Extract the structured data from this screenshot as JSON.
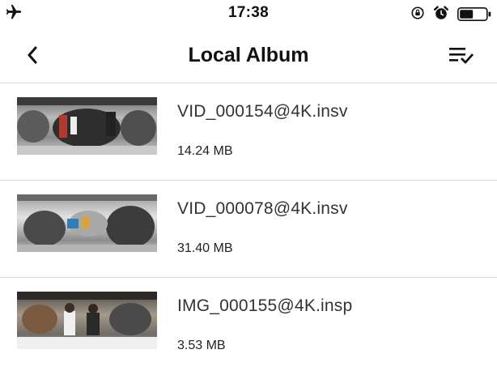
{
  "status_bar": {
    "time": "17:38",
    "icons": [
      "airplane-icon",
      "rotation-lock-icon",
      "alarm-icon",
      "battery-icon"
    ],
    "battery_level": 0.5
  },
  "nav": {
    "title": "Local Album",
    "back_icon": "chevron-left-icon",
    "select_icon": "multi-select-checklist-icon"
  },
  "files": [
    {
      "name": "VID_000154@4K.insv",
      "size": "14.24 MB"
    },
    {
      "name": "VID_000078@4K.insv",
      "size": "31.40 MB"
    },
    {
      "name": "IMG_000155@4K.insp",
      "size": "3.53 MB"
    }
  ],
  "colors": {
    "divider": "#d9d9d9",
    "text_primary": "#111111",
    "text_secondary": "#333333"
  }
}
